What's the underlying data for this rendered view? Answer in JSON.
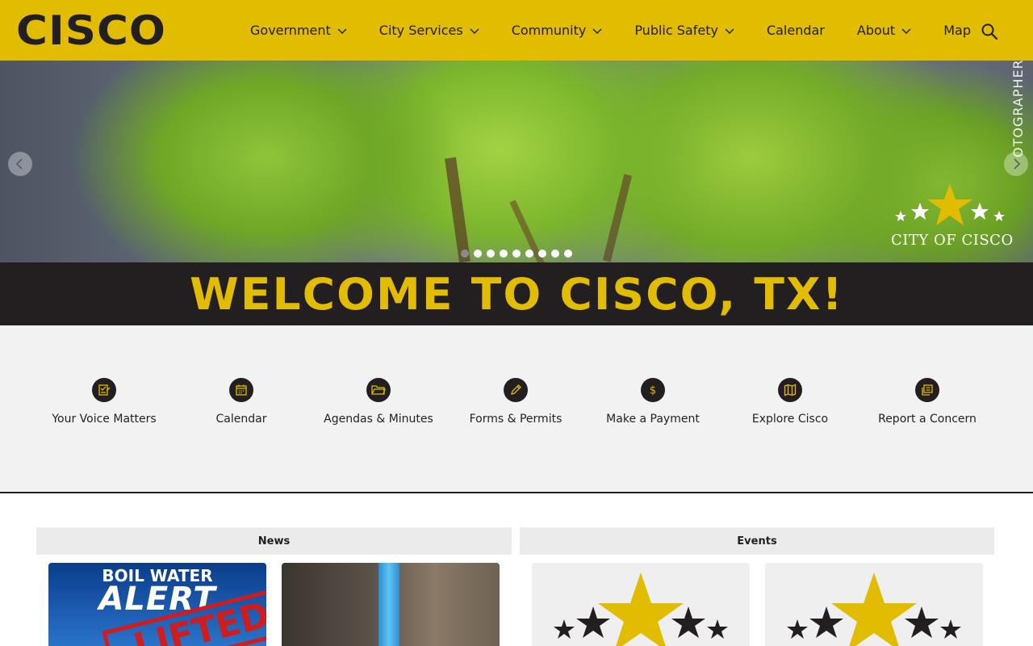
{
  "header": {
    "logo": "CISCO",
    "nav": [
      {
        "label": "Government",
        "has_dropdown": true
      },
      {
        "label": "City Services",
        "has_dropdown": true
      },
      {
        "label": "Community",
        "has_dropdown": true
      },
      {
        "label": "Public Safety",
        "has_dropdown": true
      },
      {
        "label": "Calendar",
        "has_dropdown": false
      },
      {
        "label": "About",
        "has_dropdown": true
      },
      {
        "label": "Map",
        "has_dropdown": false
      }
    ],
    "search_icon": "search-icon"
  },
  "hero": {
    "watermark": "CITY OF CISCO",
    "photo_credit_partial": "OTOGRAPHER",
    "slide_count": 9,
    "active_slide": 1
  },
  "welcome": {
    "title": "WELCOME TO CISCO, TX!"
  },
  "quick_links": [
    {
      "label": "Your Voice Matters",
      "icon": "checklist-icon"
    },
    {
      "label": "Calendar",
      "icon": "calendar-icon"
    },
    {
      "label": "Agendas & Minutes",
      "icon": "folder-icon"
    },
    {
      "label": "Forms & Permits",
      "icon": "pencil-icon"
    },
    {
      "label": "Make a Payment",
      "icon": "dollar-icon"
    },
    {
      "label": "Explore Cisco",
      "icon": "map-icon"
    },
    {
      "label": "Report a Concern",
      "icon": "report-icon"
    }
  ],
  "sections": {
    "news_label": "News",
    "events_label": "Events"
  },
  "news_cards": [
    {
      "headline_top": "BOIL WATER",
      "headline_main": "ALERT",
      "stamp": "LIFTED"
    },
    {
      "image": "water-pipe-photo"
    }
  ],
  "colors": {
    "brand_yellow": "#e2bc00",
    "brand_dark": "#231f20",
    "quick_bg": "#f2f2f2"
  }
}
